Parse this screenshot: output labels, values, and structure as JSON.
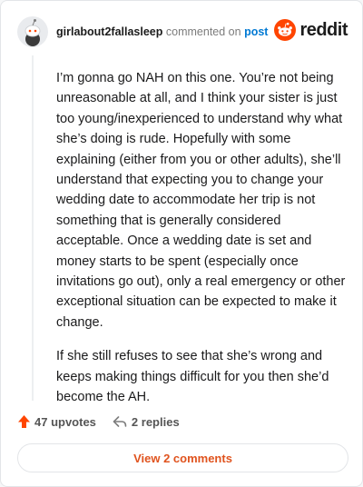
{
  "comment": {
    "username": "girlabout2fallasleep",
    "action_text": "commented on",
    "post_link": "post",
    "paragraphs": [
      "I’m gonna go NAH on this one. You’re not being unreasonable at all, and I think your sister is just too young/inexperienced to understand why what she’s doing is rude. Hopefully with some explaining (either from you or other adults), she’ll understand that expecting you to change your wedding date to accommodate her trip is not something that is generally considered acceptable. Once a wedding date is set and money starts to be spent (especially once invitations go out), only a real emergency or other exceptional situation can be expected to make it change.",
      "If she still refuses to see that she’s wrong and keeps making things difficult for you then she’d become the AH."
    ],
    "upvotes": "47 upvotes",
    "replies": "2 replies",
    "view_comments": "View 2 comments"
  },
  "brand": {
    "name": "reddit",
    "color": "#ff4500"
  },
  "icons": {
    "avatar": "snoo-avatar-icon",
    "logo": "reddit-snoo-icon",
    "upvote": "upvote-arrow-icon",
    "reply": "reply-arrow-icon"
  },
  "colors": {
    "upvote": "#ff4500",
    "link": "#0079d3",
    "view_button_text": "#e0531e"
  }
}
